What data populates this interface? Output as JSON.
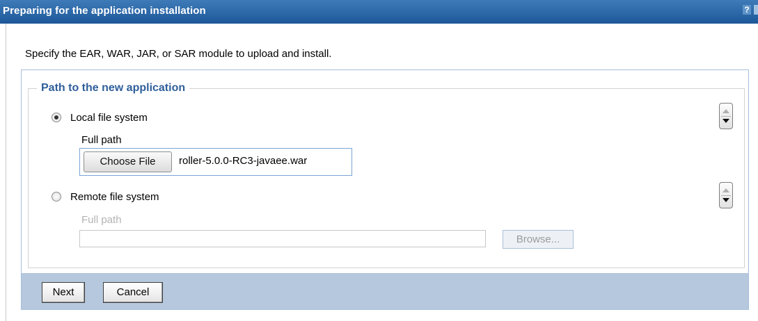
{
  "window": {
    "title": "Preparing for the application installation",
    "help_glyph": "?"
  },
  "intro_text": "Specify the EAR, WAR, JAR, or SAR module to upload and install.",
  "path_section": {
    "legend": "Path to the new application",
    "local": {
      "label": "Local file system",
      "selected": true,
      "full_path_label": "Full path",
      "choose_file_label": "Choose File",
      "file_name": "roller-5.0.0-RC3-javaee.war"
    },
    "remote": {
      "label": "Remote file system",
      "selected": false,
      "full_path_label": "Full path",
      "path_value": "",
      "browse_label": "Browse..."
    }
  },
  "footer": {
    "next_label": "Next",
    "cancel_label": "Cancel"
  },
  "colors": {
    "title_bar": "#1d5799",
    "legend_text": "#2f5f9a",
    "footer_bg": "#b6c8dd"
  }
}
